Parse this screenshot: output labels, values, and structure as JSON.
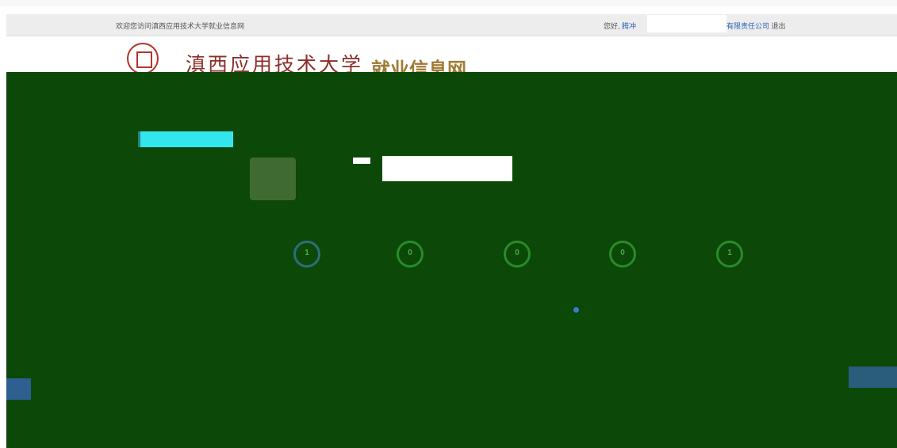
{
  "bookmarks": [
    "",
    "",
    "",
    "",
    "",
    "",
    "",
    ""
  ],
  "topbar": {
    "welcome": "欢迎您访问滇西应用技术大学就业信息网",
    "greeting": "您好, ",
    "company_start": "腾冲",
    "company_end": "有限责任公司",
    "logout": "退出"
  },
  "header": {
    "university_name": "滇西应用技术大学",
    "site_name": "就业信息网"
  },
  "sidebar": {
    "items": [
      {
        "label": ""
      },
      {
        "label": ""
      },
      {
        "label": ""
      },
      {
        "label": ""
      }
    ]
  },
  "profile": {
    "name": "",
    "status": ""
  },
  "stats": [
    {
      "value": "1"
    },
    {
      "value": "0"
    },
    {
      "value": "0"
    },
    {
      "value": "0"
    },
    {
      "value": "1"
    }
  ],
  "notice": {
    "text": ""
  },
  "right_button": {
    "label": ""
  },
  "colors": {
    "accent_blue": "#2a63b8",
    "title_red": "#8b2e2a",
    "site_gold": "#a07a35",
    "active_menu": "#33e6ee",
    "stat_green": "#2a8a2a"
  }
}
